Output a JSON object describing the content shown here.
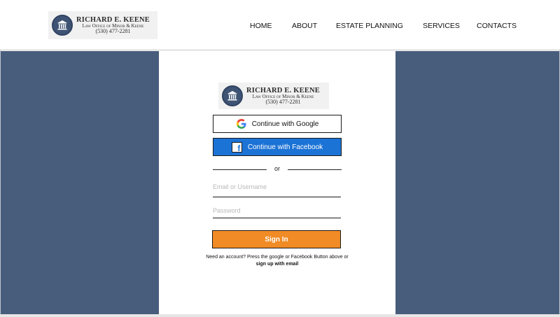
{
  "header": {
    "logo": {
      "name": "RICHARD E. KEENE",
      "subtitle": "Law Office of Minor & Keene",
      "phone": "(530) 477-2281"
    },
    "nav": [
      "HOME",
      "ABOUT",
      "ESTATE PLANNING",
      "SERVICES",
      "CONTACTS"
    ]
  },
  "login": {
    "logo": {
      "name": "RICHARD E. KEENE",
      "subtitle": "Law Office of Minor & Keene",
      "phone": "(530) 477-2281"
    },
    "google_label": "Continue with Google",
    "facebook_label": "Continue with Facebook",
    "divider_text": "or",
    "email_placeholder": "Email or Username",
    "password_placeholder": "Password",
    "signin_label": "Sign In",
    "note_text": "Need an account? Press the google or Facebook Button above or",
    "note_link": "sign up with email"
  },
  "colors": {
    "side_panel": "#485c7c",
    "facebook_button": "#1c73d6",
    "signin_button": "#f08b25",
    "seal": "#3f5474"
  },
  "icons": {
    "seal": "courthouse-icon",
    "google": "google-icon",
    "facebook": "facebook-icon"
  }
}
